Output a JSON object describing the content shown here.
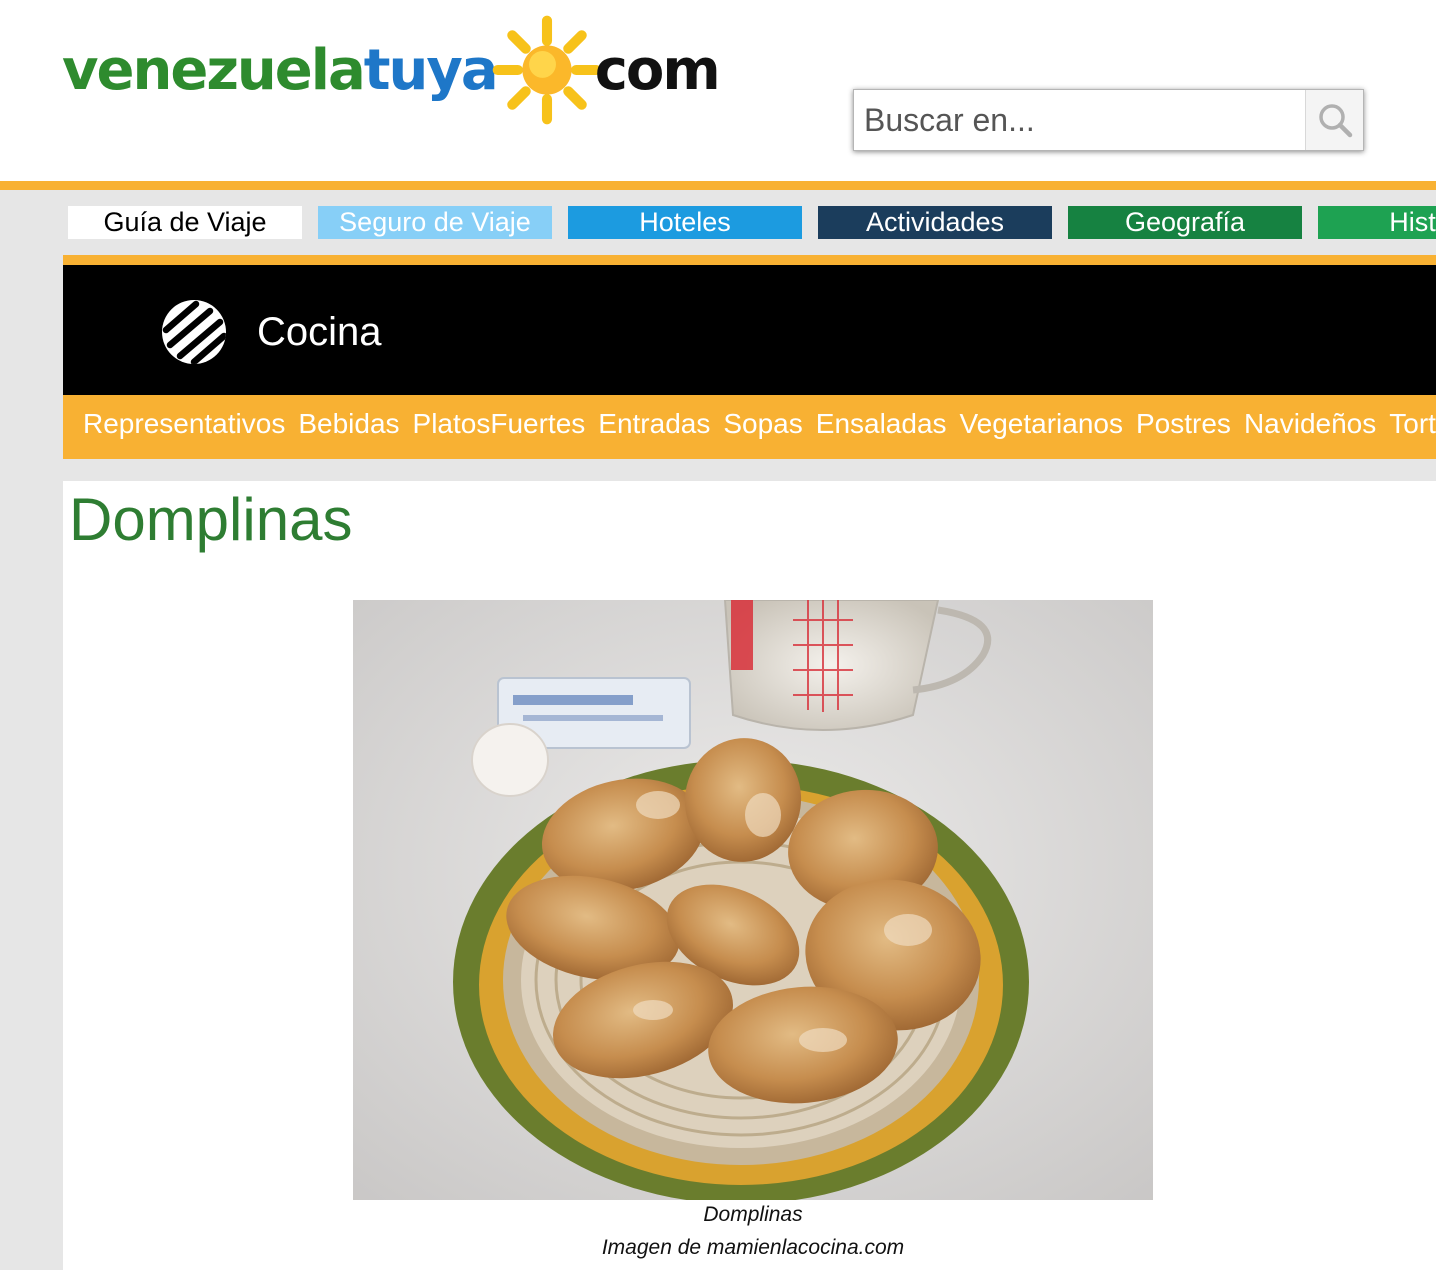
{
  "logo": {
    "part1": "venezuela",
    "part2": "tuya",
    "part3": "com"
  },
  "search": {
    "placeholder": "Buscar en..."
  },
  "top_nav": [
    {
      "label": "Guía de Viaje",
      "bg": "#ffffff",
      "fg": "#000000"
    },
    {
      "label": "Seguro de Viaje",
      "bg": "#87cff7",
      "fg": "#ffffff"
    },
    {
      "label": "Hoteles",
      "bg": "#1c9be0",
      "fg": "#ffffff"
    },
    {
      "label": "Actividades",
      "bg": "#1b3d5c",
      "fg": "#ffffff"
    },
    {
      "label": "Geografía",
      "bg": "#168241",
      "fg": "#ffffff"
    },
    {
      "label": "Historia",
      "bg": "#1ea252",
      "fg": "#ffffff"
    }
  ],
  "section": {
    "title": "Cocina"
  },
  "sub_nav": [
    "Representativos",
    "Bebidas",
    "PlatosFuertes",
    "Entradas",
    "Sopas",
    "Ensaladas",
    "Vegetarianos",
    "Postres",
    "Navideños",
    "Tortas"
  ],
  "article": {
    "title": "Domplinas",
    "image_caption": "Domplinas",
    "image_credit": "Imagen de mamienlacocina.com"
  },
  "colors": {
    "accent_orange": "#f8b133",
    "title_green": "#2e7d32",
    "section_bar": "#000000"
  }
}
